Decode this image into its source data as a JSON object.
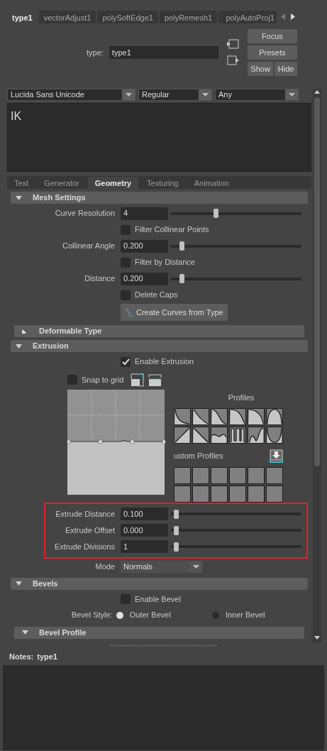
{
  "node_tabs": [
    {
      "label": "type1",
      "selected": true
    },
    {
      "label": "vectorAdjust1",
      "selected": false
    },
    {
      "label": "polySoftEdge1",
      "selected": false
    },
    {
      "label": "polyRemesh1",
      "selected": false
    },
    {
      "label": "polyAutoProj1",
      "selected": false
    }
  ],
  "type_field": {
    "label": "type:",
    "value": "type1"
  },
  "buttons": [
    "Focus",
    "Presets",
    "Show",
    "Hide"
  ],
  "font": {
    "family": "Lucida Sans Unicode",
    "style": "Regular",
    "writing_system": "Any"
  },
  "text_input": {
    "value": "IK"
  },
  "tabs": [
    {
      "label": "Text",
      "selected": false
    },
    {
      "label": "Generator",
      "selected": false
    },
    {
      "label": "Geometry",
      "selected": true
    },
    {
      "label": "Texturing",
      "selected": false
    },
    {
      "label": "Animation",
      "selected": false
    }
  ],
  "sections": [
    {
      "title": "Mesh Settings",
      "expanded": true,
      "nested": false,
      "rows": [
        {
          "kind": "slider",
          "label": "Curve Resolution",
          "value": "4",
          "level": 0.34,
          "highlighted": false
        },
        {
          "kind": "checkbox",
          "label": "Filter Collinear Points",
          "checked": false
        },
        {
          "kind": "slider",
          "label": "Collinear Angle",
          "value": "0.200",
          "level": 0.07,
          "highlighted": false
        },
        {
          "kind": "checkbox",
          "label": "Filter by Distance",
          "checked": false
        },
        {
          "kind": "slider",
          "label": "Distance",
          "value": "0.200",
          "level": 0.07,
          "highlighted": false
        },
        {
          "kind": "checkbox",
          "label": "Delete Caps",
          "checked": false
        },
        {
          "kind": "button",
          "label": "Create Curves from Type"
        }
      ]
    },
    {
      "title": "Deformable Type",
      "expanded": false,
      "nested": true
    },
    {
      "title": "Extrusion",
      "expanded": true,
      "nested": false,
      "rows": [
        {
          "kind": "checkbox",
          "label": "Enable Extrusion",
          "checked": true
        },
        {
          "kind": "profile_editor",
          "snap": {
            "label": "Snap to grid",
            "checked": false
          },
          "profiles_label": "Profiles",
          "custom_label": "ustom Profiles"
        },
        {
          "kind": "slider",
          "label": "Extrude Distance",
          "value": "0.100",
          "level": 0.02,
          "highlighted": true
        },
        {
          "kind": "slider",
          "label": "Extrude Offset",
          "value": "0.000",
          "level": 0.02,
          "highlighted": true
        },
        {
          "kind": "slider",
          "label": "Extrude Divisions",
          "value": "1",
          "level": 0.02,
          "highlighted": true
        },
        {
          "kind": "dropdown",
          "label": "Mode",
          "value": "Normals"
        }
      ]
    },
    {
      "title": "Bevels",
      "expanded": true,
      "nested": false,
      "rows": [
        {
          "kind": "checkbox",
          "label": "Enable Bevel",
          "checked": false
        },
        {
          "kind": "radio",
          "label": "Bevel Style:",
          "options": [
            {
              "label": "Outer Bevel",
              "selected": true
            },
            {
              "label": "Inner Bevel",
              "selected": false
            }
          ]
        }
      ]
    },
    {
      "title": "Bevel Profile",
      "expanded": true,
      "nested": true
    }
  ],
  "notes": {
    "label": "Notes:",
    "value": "type1"
  }
}
